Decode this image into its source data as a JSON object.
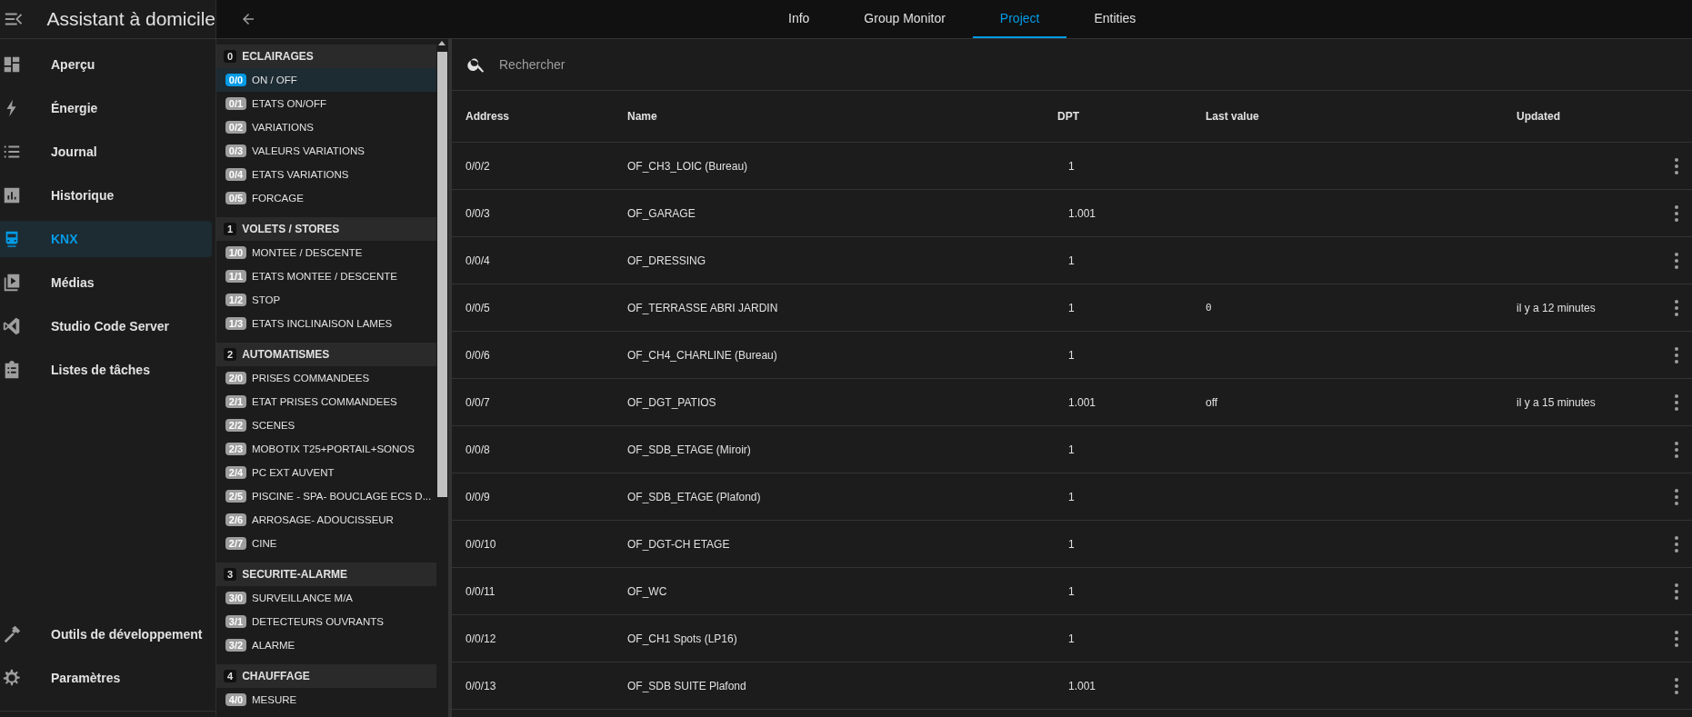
{
  "app_title": "Assistant à domicile",
  "sidebar": {
    "items": [
      {
        "label": "Aperçu",
        "selected": false
      },
      {
        "label": "Énergie",
        "selected": false
      },
      {
        "label": "Journal",
        "selected": false
      },
      {
        "label": "Historique",
        "selected": false
      },
      {
        "label": "KNX",
        "selected": true
      },
      {
        "label": "Médias",
        "selected": false
      },
      {
        "label": "Studio Code Server",
        "selected": false
      },
      {
        "label": "Listes de tâches",
        "selected": false
      }
    ],
    "bottom_items": [
      {
        "label": "Outils de développement",
        "selected": false
      },
      {
        "label": "Paramètres",
        "selected": false
      }
    ]
  },
  "tabs": [
    {
      "label": "Info",
      "selected": false
    },
    {
      "label": "Group Monitor",
      "selected": false
    },
    {
      "label": "Project",
      "selected": true
    },
    {
      "label": "Entities",
      "selected": false
    }
  ],
  "group_tree": [
    {
      "badge": "0",
      "label": "ECLAIRAGES",
      "children": [
        {
          "badge": "0/0",
          "label": "ON / OFF",
          "selected": true
        },
        {
          "badge": "0/1",
          "label": "ETATS ON/OFF",
          "selected": false
        },
        {
          "badge": "0/2",
          "label": "VARIATIONS",
          "selected": false
        },
        {
          "badge": "0/3",
          "label": "VALEURS VARIATIONS",
          "selected": false
        },
        {
          "badge": "0/4",
          "label": "ETATS VARIATIONS",
          "selected": false
        },
        {
          "badge": "0/5",
          "label": "FORCAGE",
          "selected": false
        }
      ]
    },
    {
      "badge": "1",
      "label": "VOLETS / STORES",
      "children": [
        {
          "badge": "1/0",
          "label": "MONTEE / DESCENTE",
          "selected": false
        },
        {
          "badge": "1/1",
          "label": "ETATS MONTEE / DESCENTE",
          "selected": false
        },
        {
          "badge": "1/2",
          "label": "STOP",
          "selected": false
        },
        {
          "badge": "1/3",
          "label": "ETATS INCLINAISON LAMES",
          "selected": false
        }
      ]
    },
    {
      "badge": "2",
      "label": "AUTOMATISMES",
      "children": [
        {
          "badge": "2/0",
          "label": "PRISES COMMANDEES",
          "selected": false
        },
        {
          "badge": "2/1",
          "label": "ETAT PRISES COMMANDEES",
          "selected": false
        },
        {
          "badge": "2/2",
          "label": "SCENES",
          "selected": false
        },
        {
          "badge": "2/3",
          "label": "MOBOTIX T25+PORTAIL+SONOS",
          "selected": false
        },
        {
          "badge": "2/4",
          "label": "PC EXT AUVENT",
          "selected": false
        },
        {
          "badge": "2/5",
          "label": "PISCINE - SPA- BOUCLAGE ECS D...",
          "selected": false
        },
        {
          "badge": "2/6",
          "label": "ARROSAGE- ADOUCISSEUR",
          "selected": false
        },
        {
          "badge": "2/7",
          "label": "CINE",
          "selected": false
        }
      ]
    },
    {
      "badge": "3",
      "label": "SECURITE-ALARME",
      "children": [
        {
          "badge": "3/0",
          "label": "SURVEILLANCE M/A",
          "selected": false
        },
        {
          "badge": "3/1",
          "label": "DETECTEURS OUVRANTS",
          "selected": false
        },
        {
          "badge": "3/2",
          "label": "ALARME",
          "selected": false
        }
      ]
    },
    {
      "badge": "4",
      "label": "CHAUFFAGE",
      "children": [
        {
          "badge": "4/0",
          "label": "MESURE",
          "selected": false
        }
      ]
    }
  ],
  "search": {
    "placeholder": "Rechercher"
  },
  "table": {
    "columns": [
      "Address",
      "Name",
      "DPT",
      "Last value",
      "Updated"
    ],
    "rows": [
      {
        "address": "0/0/2",
        "name": "OF_CH3_LOIC (Bureau)",
        "dpt": "1"
      },
      {
        "address": "0/0/3",
        "name": "OF_GARAGE",
        "dpt": "1.001"
      },
      {
        "address": "0/0/4",
        "name": "OF_DRESSING",
        "dpt": "1"
      },
      {
        "address": "0/0/5",
        "name": "OF_TERRASSE ABRI JARDIN",
        "dpt": "1",
        "last_value": "0",
        "updated": "il y a 12 minutes"
      },
      {
        "address": "0/0/6",
        "name": "OF_CH4_CHARLINE (Bureau)",
        "dpt": "1"
      },
      {
        "address": "0/0/7",
        "name": "OF_DGT_PATIOS",
        "dpt": "1.001",
        "last_value": "off",
        "updated": "il y a 15 minutes"
      },
      {
        "address": "0/0/8",
        "name": "OF_SDB_ETAGE (Miroir)",
        "dpt": "1"
      },
      {
        "address": "0/0/9",
        "name": "OF_SDB_ETAGE (Plafond)",
        "dpt": "1"
      },
      {
        "address": "0/0/10",
        "name": "OF_DGT-CH ETAGE",
        "dpt": "1"
      },
      {
        "address": "0/0/11",
        "name": "OF_WC",
        "dpt": "1"
      },
      {
        "address": "0/0/12",
        "name": "OF_CH1 Spots (LP16)",
        "dpt": "1"
      },
      {
        "address": "0/0/13",
        "name": "OF_SDB SUITE Plafond",
        "dpt": "1.001"
      }
    ]
  }
}
